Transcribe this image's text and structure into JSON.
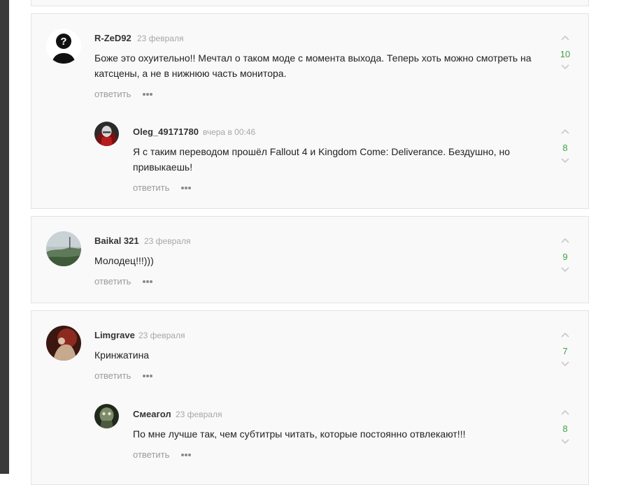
{
  "colors": {
    "score": "#43a047",
    "reply": "#9b9b9b",
    "date": "#a7a7a7"
  },
  "comments": [
    {
      "author": "R-ZeD92",
      "date": "23 февраля",
      "text": "Боже это охуительно!! Мечтал о таком моде с момента выхода. Теперь хоть можно смотреть на катсцены, а не в нижнюю часть монитора.",
      "score": "10",
      "reply": "ответить",
      "avatar": "default-user-avatar",
      "replies": [
        {
          "author": "Oleg_49171780",
          "date": "вчера в 00:46",
          "text": "Я с таким переводом прошёл Fallout 4 и Kingdom Come: Deliverance. Бездушно, но привыкаешь!",
          "score": "8",
          "reply": "ответить",
          "avatar": "hooded-figure-avatar"
        }
      ]
    },
    {
      "author": "Baikal 321",
      "date": "23 февраля",
      "text": "Молодец!!!)))",
      "score": "9",
      "reply": "ответить",
      "avatar": "landscape-avatar",
      "replies": []
    },
    {
      "author": "Limgrave",
      "date": "23 февраля",
      "text": "Кринжатина",
      "score": "7",
      "reply": "ответить",
      "avatar": "painting-avatar",
      "replies": [
        {
          "author": "Смеагол",
          "date": "23 февраля",
          "text": "По мне лучше так, чем субтитры читать, которые постоянно отвлекают!!!",
          "score": "8",
          "reply": "ответить",
          "avatar": "gollum-avatar"
        }
      ]
    }
  ]
}
